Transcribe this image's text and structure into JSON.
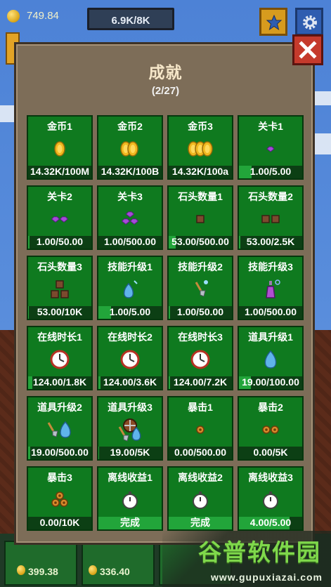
{
  "hud": {
    "coins": "749.84",
    "hp": "6.9K/8K"
  },
  "modal": {
    "title": "成就",
    "count": "(2/27)"
  },
  "achievements": [
    {
      "label": "金币1",
      "icon": "coin-1-icon",
      "value": "14.32K/100M",
      "progress": 0
    },
    {
      "label": "金币2",
      "icon": "coin-2-icon",
      "value": "14.32K/100B",
      "progress": 0
    },
    {
      "label": "金币3",
      "icon": "coin-3-icon",
      "value": "14.32K/100a",
      "progress": 0
    },
    {
      "label": "关卡1",
      "icon": "gem-1-icon",
      "value": "1.00/5.00",
      "progress": 0.2
    },
    {
      "label": "关卡2",
      "icon": "gem-2-icon",
      "value": "1.00/50.00",
      "progress": 0.02
    },
    {
      "label": "关卡3",
      "icon": "gem-3-icon",
      "value": "1.00/500.00",
      "progress": 0
    },
    {
      "label": "石头数量1",
      "icon": "stone-1-icon",
      "value": "53.00/500.00",
      "progress": 0.106
    },
    {
      "label": "石头数量2",
      "icon": "stone-2-icon",
      "value": "53.00/2.5K",
      "progress": 0.02
    },
    {
      "label": "石头数量3",
      "icon": "stone-3-icon",
      "value": "53.00/10K",
      "progress": 0.005
    },
    {
      "label": "技能升级1",
      "icon": "potion-blue-icon",
      "value": "1.00/5.00",
      "progress": 0.2
    },
    {
      "label": "技能升级2",
      "icon": "shovel-icon",
      "value": "1.00/50.00",
      "progress": 0.02
    },
    {
      "label": "技能升级3",
      "icon": "potion-purple-icon",
      "value": "1.00/500.00",
      "progress": 0
    },
    {
      "label": "在线时长1",
      "icon": "clock-icon",
      "value": "124.00/1.8K",
      "progress": 0.069
    },
    {
      "label": "在线时长2",
      "icon": "clock-icon",
      "value": "124.00/3.6K",
      "progress": 0.034
    },
    {
      "label": "在线时长3",
      "icon": "clock-icon",
      "value": "124.00/7.2K",
      "progress": 0.017
    },
    {
      "label": "道具升级1",
      "icon": "water-drop-icon",
      "value": "19.00/100.00",
      "progress": 0.19
    },
    {
      "label": "道具升级2",
      "icon": "shovel-drop-icon",
      "value": "19.00/500.00",
      "progress": 0.038
    },
    {
      "label": "道具升级3",
      "icon": "shield-tools-icon",
      "value": "19.00/5K",
      "progress": 0.004
    },
    {
      "label": "暴击1",
      "icon": "crit-1-icon",
      "value": "0.00/500.00",
      "progress": 0
    },
    {
      "label": "暴击2",
      "icon": "crit-2-icon",
      "value": "0.00/5K",
      "progress": 0
    },
    {
      "label": "暴击3",
      "icon": "crit-3-icon",
      "value": "0.00/10K",
      "progress": 0
    },
    {
      "label": "离线收益1",
      "icon": "stopwatch-icon",
      "value": "完成",
      "progress": 1
    },
    {
      "label": "离线收益2",
      "icon": "stopwatch-icon",
      "value": "完成",
      "progress": 1
    },
    {
      "label": "离线收益3",
      "icon": "stopwatch-icon",
      "value": "4.00/5.00",
      "progress": 0.8
    }
  ],
  "bottom": {
    "values": [
      "399.38",
      "336.40"
    ]
  },
  "watermark": {
    "cn": "谷普软件园",
    "en": "www.gupuxiazai.com"
  }
}
